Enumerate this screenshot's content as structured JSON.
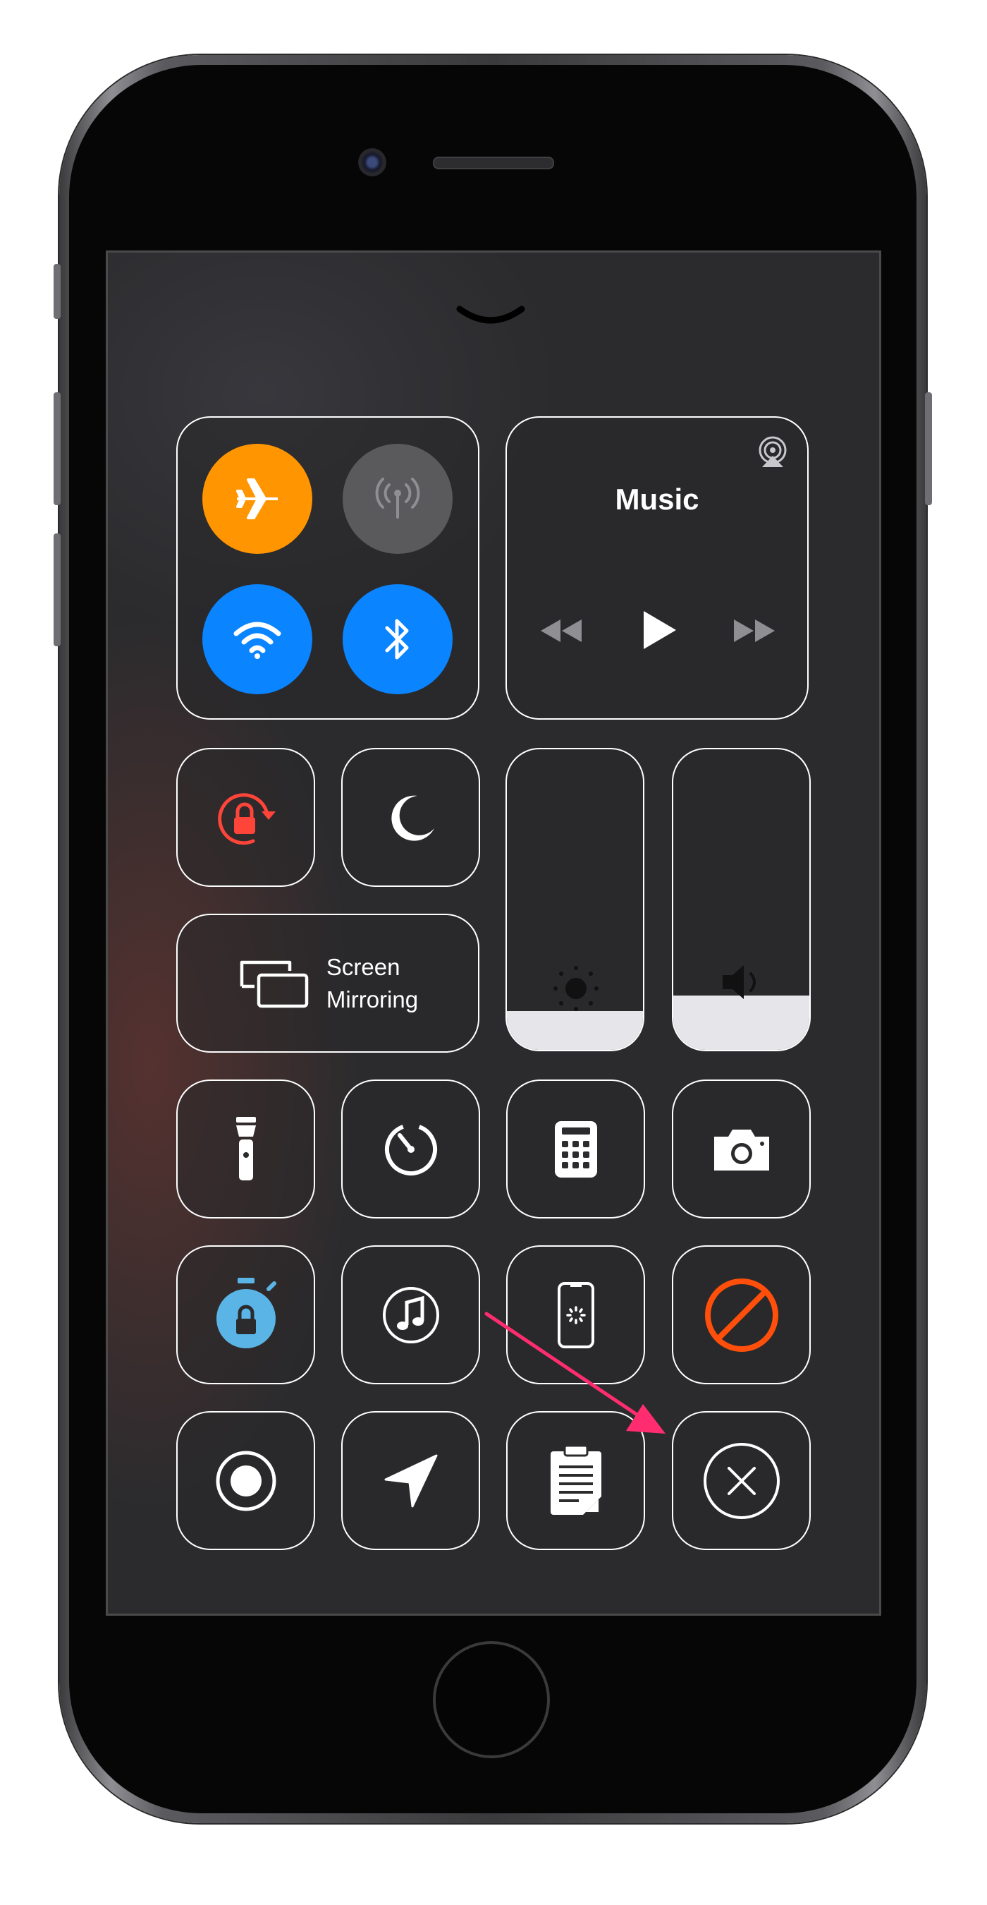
{
  "control_center": {
    "connectivity": {
      "airplane_mode": {
        "icon": "airplane-icon",
        "color": "#ff9500",
        "state": "on"
      },
      "cellular_data": {
        "icon": "antenna-icon",
        "color": "#5a5a5c",
        "state": "off"
      },
      "wifi": {
        "icon": "wifi-icon",
        "color": "#0a84ff",
        "state": "on"
      },
      "bluetooth": {
        "icon": "bluetooth-icon",
        "color": "#0a84ff",
        "state": "on"
      }
    },
    "music": {
      "title": "Music",
      "airplay_icon": "airplay-icon",
      "controls": [
        "rewind-icon",
        "play-icon",
        "fast-forward-icon"
      ]
    },
    "orientation_lock": {
      "icon": "rotation-lock-icon",
      "color": "#ff453a"
    },
    "do_not_disturb": {
      "icon": "moon-icon"
    },
    "screen_mirroring": {
      "line1": "Screen",
      "line2": "Mirroring",
      "icon": "screen-mirroring-icon"
    },
    "brightness": {
      "icon": "sun-icon",
      "level": 0.13
    },
    "volume": {
      "icon": "speaker-icon",
      "level": 0.18
    },
    "row3": [
      "flashlight-icon",
      "timer-icon",
      "calculator-icon",
      "camera-icon"
    ],
    "row4": [
      {
        "icon": "guided-access-icon",
        "color": "#5ab4e5"
      },
      {
        "icon": "music-recognition-icon"
      },
      {
        "icon": "screen-time-icon"
      },
      {
        "icon": "do-not-disturb-driving-icon",
        "color": "#ff4f0a"
      }
    ],
    "row5": [
      "screen-record-icon",
      "location-icon",
      "notes-icon",
      "close-icon"
    ],
    "annotation": {
      "icon": "pointer-arrow-icon",
      "color": "#ff2d6f"
    }
  }
}
